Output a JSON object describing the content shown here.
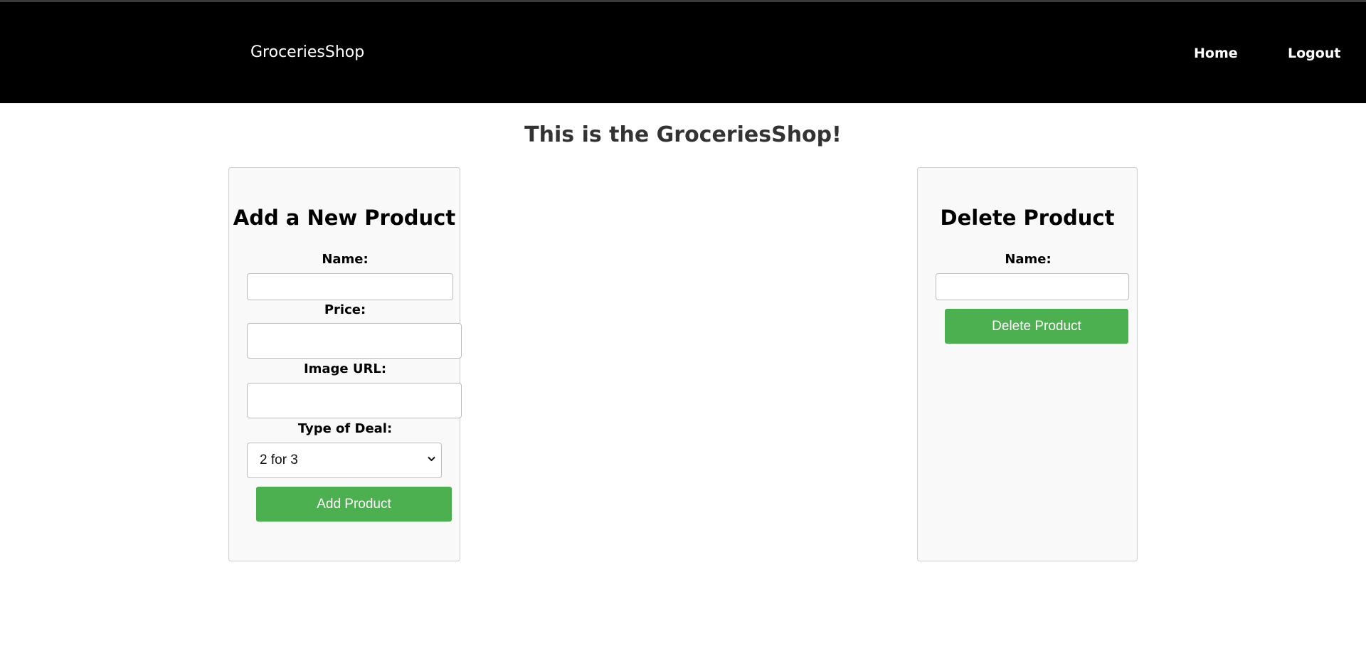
{
  "header": {
    "brand": "GroceriesShop",
    "nav": {
      "home": "Home",
      "logout": "Logout"
    },
    "background": "#000000"
  },
  "main": {
    "title": "This is the GroceriesShop!"
  },
  "add_product": {
    "title": "Add a New Product",
    "name_label": "Name:",
    "name_value": "",
    "price_label": "Price:",
    "price_value": "",
    "image_label": "Image URL:",
    "image_value": "",
    "deal_label": "Type of Deal:",
    "deal_selected": "2 for 3",
    "submit_label": "Add Product"
  },
  "delete_product": {
    "title": "Delete Product",
    "name_label": "Name:",
    "name_value": "",
    "submit_label": "Delete Product"
  },
  "colors": {
    "accent": "#4caf50",
    "panel_bg": "#f9f9f9"
  },
  "icons": {
    "select_arrow": "chevron-down-icon"
  }
}
